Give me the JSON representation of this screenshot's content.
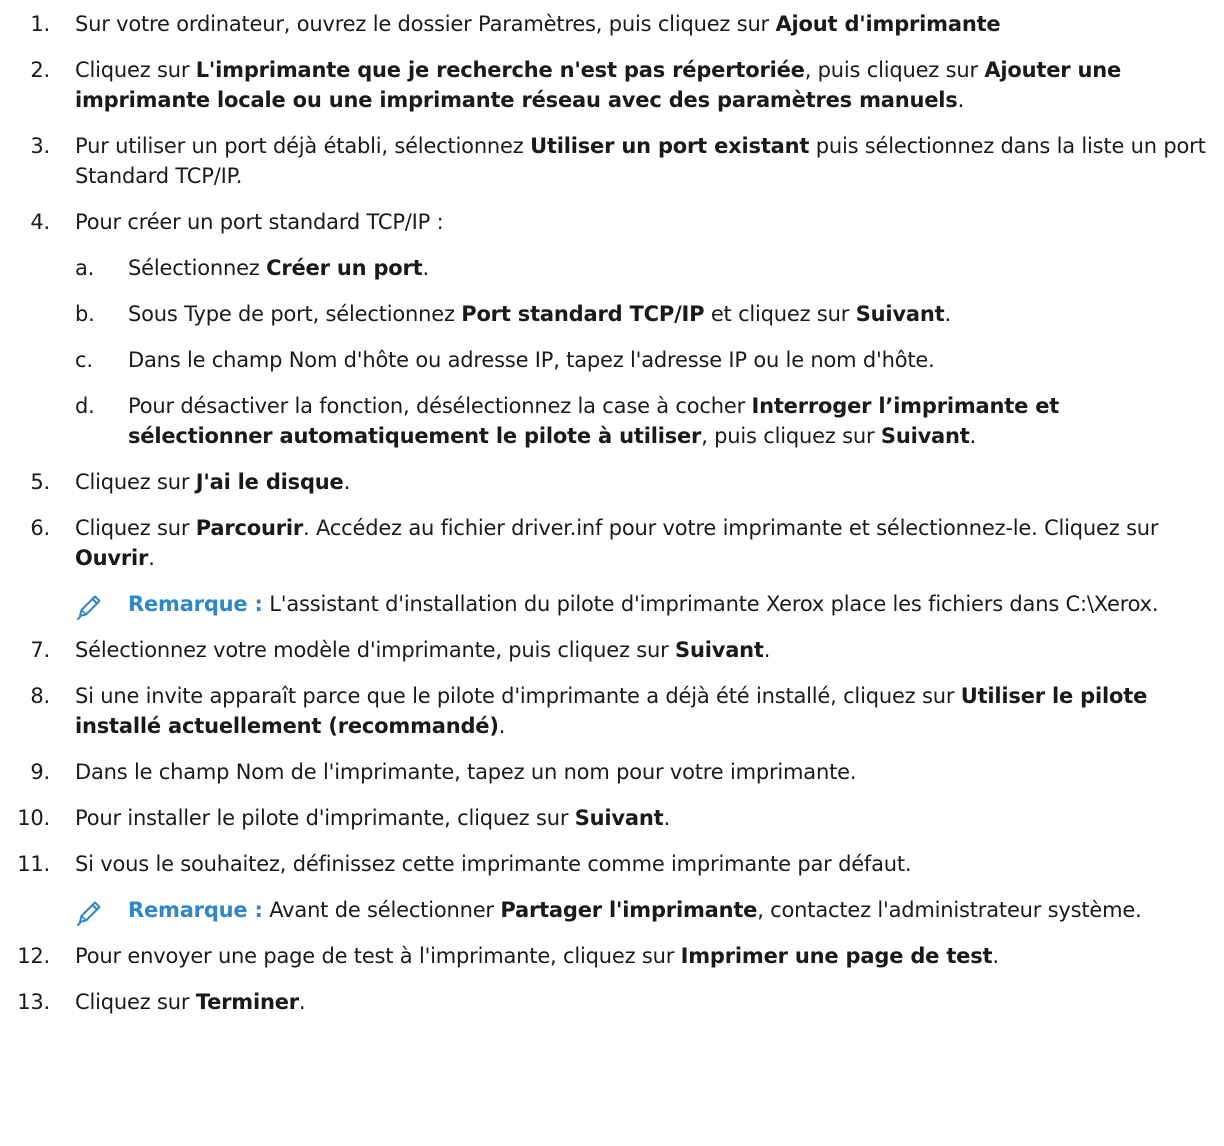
{
  "steps": {
    "s1": {
      "num": "1.",
      "t1": "Sur votre ordinateur, ouvrez le dossier Paramètres, puis cliquez sur ",
      "b1": "Ajout d'imprimante"
    },
    "s2": {
      "num": "2.",
      "t1": "Cliquez sur ",
      "b1": "L'imprimante que je recherche n'est pas répertoriée",
      "t2": ", puis cliquez sur ",
      "b2": "Ajouter une imprimante locale ou une imprimante réseau avec des paramètres manuels",
      "t3": "."
    },
    "s3": {
      "num": "3.",
      "t1": "Pur utiliser un port déjà établi, sélectionnez ",
      "b1": "Utiliser un port existant",
      "t2": " puis sélectionnez dans la liste un port Standard TCP/IP."
    },
    "s4": {
      "num": "4.",
      "t1": "Pour créer un port standard TCP/IP :"
    },
    "s4a": {
      "letter": "a.",
      "t1": "Sélectionnez ",
      "b1": "Créer un port",
      "t2": "."
    },
    "s4b": {
      "letter": "b.",
      "t1": "Sous Type de port, sélectionnez ",
      "b1": "Port standard TCP/IP",
      "t2": " et cliquez sur ",
      "b2": "Suivant",
      "t3": "."
    },
    "s4c": {
      "letter": "c.",
      "t1": "Dans le champ Nom d'hôte ou adresse IP, tapez l'adresse IP ou le nom d'hôte."
    },
    "s4d": {
      "letter": "d.",
      "t1": "Pour désactiver la fonction, désélectionnez la case à cocher ",
      "b1": "Interroger l’imprimante et sélectionner automatiquement le pilote à utiliser",
      "t2": ", puis cliquez sur ",
      "b2": "Suivant",
      "t3": "."
    },
    "s5": {
      "num": "5.",
      "t1": "Cliquez sur ",
      "b1": "J'ai le disque",
      "t2": "."
    },
    "s6": {
      "num": "6.",
      "t1": "Cliquez sur ",
      "b1": "Parcourir",
      "t2": ". Accédez au fichier driver.inf pour votre imprimante et sélectionnez-le. Cliquez sur ",
      "b2": "Ouvrir",
      "t3": "."
    },
    "n1": {
      "label": "Remarque :",
      "t1": " L'assistant d'installation du pilote d'imprimante Xerox place les fichiers dans C:\\Xerox."
    },
    "s7": {
      "num": "7.",
      "t1": "Sélectionnez votre modèle d'imprimante, puis cliquez sur ",
      "b1": "Suivant",
      "t2": "."
    },
    "s8": {
      "num": "8.",
      "t1": "Si une invite apparaît parce que le pilote d'imprimante a déjà été installé, cliquez sur ",
      "b1": "Utiliser le pilote installé actuellement (recommandé)",
      "t2": "."
    },
    "s9": {
      "num": "9.",
      "t1": " Dans le champ Nom de l'imprimante, tapez un nom pour votre imprimante."
    },
    "s10": {
      "num": "10.",
      "t1": "Pour installer le pilote d'imprimante, cliquez sur ",
      "b1": "Suivant",
      "t2": "."
    },
    "s11": {
      "num": "11.",
      "t1": "Si vous le souhaitez, définissez cette imprimante comme imprimante par défaut."
    },
    "n2": {
      "label": "Remarque :",
      "t1": " Avant de sélectionner ",
      "b1": "Partager l'imprimante",
      "t2": ", contactez l'administrateur système."
    },
    "s12": {
      "num": "12.",
      "t1": "Pour envoyer une page de test à l'imprimante, cliquez sur ",
      "b1": "Imprimer une page de test",
      "t2": "."
    },
    "s13": {
      "num": "13.",
      "t1": "Cliquez sur ",
      "b1": "Terminer",
      "t2": "."
    }
  },
  "icons": {
    "note": "pencil-icon"
  },
  "colors": {
    "note_label": "#2f87c8",
    "icon": "#2f87c8",
    "text": "#1a1a1a"
  }
}
